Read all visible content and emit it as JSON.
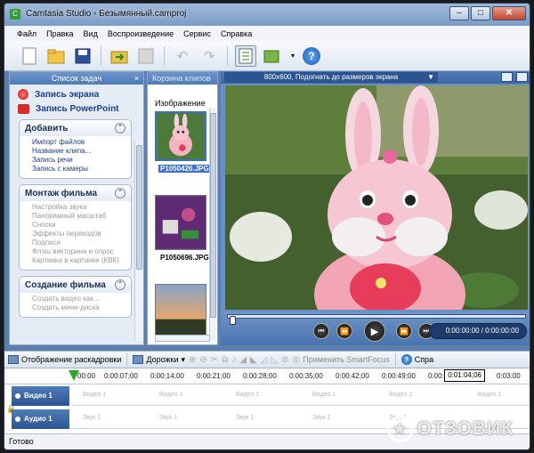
{
  "window": {
    "title": "Camtasia Studio - Безымянный.camproj"
  },
  "menu": [
    "Файл",
    "Правка",
    "Вид",
    "Воспроизведение",
    "Сервис",
    "Справка"
  ],
  "toolbar": {
    "icons": [
      "new-file-icon",
      "open-folder-icon",
      "save-icon",
      "import-icon",
      "save-disabled-icon",
      "undo-icon",
      "redo-icon",
      "task-list-icon",
      "produce-icon",
      "help-icon"
    ],
    "help_label": "?"
  },
  "task_pane": {
    "header": "Список задач",
    "close": "×",
    "record_screen": "Запись экрана",
    "record_powerpoint": "Запись PowerPoint",
    "sections": [
      {
        "title": "Добавить",
        "items": [
          "Импорт файлов",
          "Название клипа...",
          "Запись речи",
          "Запись с камеры"
        ]
      },
      {
        "title": "Монтаж фильма",
        "items": [
          "Настройка звука",
          "Панорамный масштаб",
          "Сноски",
          "Эффекты переходов",
          "Подписи",
          "Флэш викторина и опрос",
          "Картинка в картинке (КВК)"
        ]
      },
      {
        "title": "Создание фильма",
        "items": [
          "Создать видео как...",
          "Создать мини-диска"
        ]
      }
    ]
  },
  "clip_bin": {
    "header": "Корзина клипов",
    "subheader": "Изображение",
    "clips": [
      "P1050426.JPG",
      "P1050696.JPG"
    ]
  },
  "preview": {
    "size_mode": "800x600, Подогнать до размеров экрана",
    "time": "0:00:00:00 / 0:00:00:00"
  },
  "timeline": {
    "storyboard_label": "Отображение раскадровки",
    "tracks_label": "Дорожки",
    "smartfocus_label": "Применить SmartFocus",
    "help_label": "Спра",
    "ticks": [
      "00:00",
      "0:00:07;00",
      "0:00:14;00",
      "0:00:21;00",
      "0:00:28;00",
      "0:00:35;00",
      "0:00:42;00",
      "0:00:49;00",
      "0:00:56;00",
      "0:03:00"
    ],
    "position": "0:01:04;06",
    "video_track": "Видео 1",
    "audio_track": "Аудио 1",
    "video_lane_label": "Видео 1",
    "audio_lane_label": "Звук 1"
  },
  "status": "Готово",
  "watermark": "ОТЗОВИК"
}
